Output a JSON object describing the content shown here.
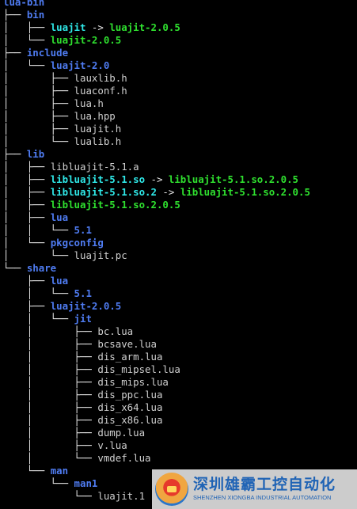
{
  "tree": [
    {
      "guides": "",
      "parts": [
        {
          "cls": "dir",
          "text": "lua-bin"
        }
      ]
    },
    {
      "guides": "├── ",
      "parts": [
        {
          "cls": "dir",
          "text": "bin"
        }
      ]
    },
    {
      "guides": "│   ├── ",
      "parts": [
        {
          "cls": "link",
          "text": "luajit"
        },
        {
          "cls": "arrow",
          "text": " -> "
        },
        {
          "cls": "exec",
          "text": "luajit-2.0.5"
        }
      ]
    },
    {
      "guides": "│   └── ",
      "parts": [
        {
          "cls": "exec",
          "text": "luajit-2.0.5"
        }
      ]
    },
    {
      "guides": "├── ",
      "parts": [
        {
          "cls": "dir",
          "text": "include"
        }
      ]
    },
    {
      "guides": "│   └── ",
      "parts": [
        {
          "cls": "dir",
          "text": "luajit-2.0"
        }
      ]
    },
    {
      "guides": "│       ├── ",
      "parts": [
        {
          "cls": "file",
          "text": "lauxlib.h"
        }
      ]
    },
    {
      "guides": "│       ├── ",
      "parts": [
        {
          "cls": "file",
          "text": "luaconf.h"
        }
      ]
    },
    {
      "guides": "│       ├── ",
      "parts": [
        {
          "cls": "file",
          "text": "lua.h"
        }
      ]
    },
    {
      "guides": "│       ├── ",
      "parts": [
        {
          "cls": "file",
          "text": "lua.hpp"
        }
      ]
    },
    {
      "guides": "│       ├── ",
      "parts": [
        {
          "cls": "file",
          "text": "luajit.h"
        }
      ]
    },
    {
      "guides": "│       └── ",
      "parts": [
        {
          "cls": "file",
          "text": "lualib.h"
        }
      ]
    },
    {
      "guides": "├── ",
      "parts": [
        {
          "cls": "dir",
          "text": "lib"
        }
      ]
    },
    {
      "guides": "│   ├── ",
      "parts": [
        {
          "cls": "file",
          "text": "libluajit-5.1.a"
        }
      ]
    },
    {
      "guides": "│   ├── ",
      "parts": [
        {
          "cls": "link",
          "text": "libluajit-5.1.so"
        },
        {
          "cls": "arrow",
          "text": " -> "
        },
        {
          "cls": "exec",
          "text": "libluajit-5.1.so.2.0.5"
        }
      ]
    },
    {
      "guides": "│   ├── ",
      "parts": [
        {
          "cls": "link",
          "text": "libluajit-5.1.so.2"
        },
        {
          "cls": "arrow",
          "text": " -> "
        },
        {
          "cls": "exec",
          "text": "libluajit-5.1.so.2.0.5"
        }
      ]
    },
    {
      "guides": "│   ├── ",
      "parts": [
        {
          "cls": "exec",
          "text": "libluajit-5.1.so.2.0.5"
        }
      ]
    },
    {
      "guides": "│   ├── ",
      "parts": [
        {
          "cls": "dir",
          "text": "lua"
        }
      ]
    },
    {
      "guides": "│   │   └── ",
      "parts": [
        {
          "cls": "dir",
          "text": "5.1"
        }
      ]
    },
    {
      "guides": "│   └── ",
      "parts": [
        {
          "cls": "dir",
          "text": "pkgconfig"
        }
      ]
    },
    {
      "guides": "│       └── ",
      "parts": [
        {
          "cls": "file",
          "text": "luajit.pc"
        }
      ]
    },
    {
      "guides": "└── ",
      "parts": [
        {
          "cls": "dir",
          "text": "share"
        }
      ]
    },
    {
      "guides": "    ├── ",
      "parts": [
        {
          "cls": "dir",
          "text": "lua"
        }
      ]
    },
    {
      "guides": "    │   └── ",
      "parts": [
        {
          "cls": "dir",
          "text": "5.1"
        }
      ]
    },
    {
      "guides": "    ├── ",
      "parts": [
        {
          "cls": "dir",
          "text": "luajit-2.0.5"
        }
      ]
    },
    {
      "guides": "    │   └── ",
      "parts": [
        {
          "cls": "dir",
          "text": "jit"
        }
      ]
    },
    {
      "guides": "    │       ├── ",
      "parts": [
        {
          "cls": "file",
          "text": "bc.lua"
        }
      ]
    },
    {
      "guides": "    │       ├── ",
      "parts": [
        {
          "cls": "file",
          "text": "bcsave.lua"
        }
      ]
    },
    {
      "guides": "    │       ├── ",
      "parts": [
        {
          "cls": "file",
          "text": "dis_arm.lua"
        }
      ]
    },
    {
      "guides": "    │       ├── ",
      "parts": [
        {
          "cls": "file",
          "text": "dis_mipsel.lua"
        }
      ]
    },
    {
      "guides": "    │       ├── ",
      "parts": [
        {
          "cls": "file",
          "text": "dis_mips.lua"
        }
      ]
    },
    {
      "guides": "    │       ├── ",
      "parts": [
        {
          "cls": "file",
          "text": "dis_ppc.lua"
        }
      ]
    },
    {
      "guides": "    │       ├── ",
      "parts": [
        {
          "cls": "file",
          "text": "dis_x64.lua"
        }
      ]
    },
    {
      "guides": "    │       ├── ",
      "parts": [
        {
          "cls": "file",
          "text": "dis_x86.lua"
        }
      ]
    },
    {
      "guides": "    │       ├── ",
      "parts": [
        {
          "cls": "file",
          "text": "dump.lua"
        }
      ]
    },
    {
      "guides": "    │       ├── ",
      "parts": [
        {
          "cls": "file",
          "text": "v.lua"
        }
      ]
    },
    {
      "guides": "    │       └── ",
      "parts": [
        {
          "cls": "file",
          "text": "vmdef.lua"
        }
      ]
    },
    {
      "guides": "    └── ",
      "parts": [
        {
          "cls": "dir",
          "text": "man"
        }
      ]
    },
    {
      "guides": "        └── ",
      "parts": [
        {
          "cls": "dir",
          "text": "man1"
        }
      ]
    },
    {
      "guides": "            └── ",
      "parts": [
        {
          "cls": "file",
          "text": "luajit.1"
        }
      ]
    }
  ],
  "watermark": {
    "company_cn": "深圳雄霸工控自动化",
    "company_en": "SHENZHEN XIONGBA INDUSTRIAL AUTOMATION"
  },
  "colors": {
    "background": "#000000",
    "directory": "#4f7cf2",
    "executable": "#2fe02f",
    "symlink": "#2fe8e8",
    "file": "#d0d0d0"
  }
}
